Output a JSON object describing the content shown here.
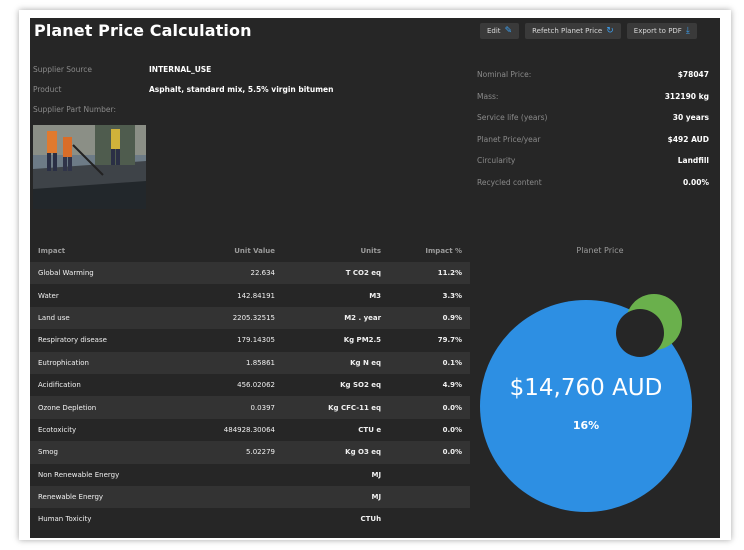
{
  "header": {
    "title": "Planet Price Calculation",
    "edit_label": "Edit",
    "refetch_label": "Refetch Planet Price",
    "export_label": "Export to PDF"
  },
  "info": {
    "supplier_source_label": "Supplier Source",
    "supplier_source_value": "INTERNAL_USE",
    "product_label": "Product",
    "product_value": "Asphalt, standard mix, 5.5% virgin bitumen",
    "part_number_label": "Supplier Part Number:"
  },
  "stats": [
    {
      "label": "Nominal Price:",
      "value": "$78047"
    },
    {
      "label": "Mass:",
      "value": "312190 kg"
    },
    {
      "label": "Service life (years)",
      "value": "30 years"
    },
    {
      "label": "Planet Price/year",
      "value": "$492 AUD"
    },
    {
      "label": "Circularity",
      "value": "Landfill"
    },
    {
      "label": "Recycled content",
      "value": "0.00%"
    }
  ],
  "impact_table": {
    "headers": [
      "Impact",
      "Unit Value",
      "Units",
      "Impact %"
    ],
    "rows": [
      {
        "impact": "Global Warming",
        "value": "22.634",
        "units": "T CO2 eq",
        "pct": "11.2%"
      },
      {
        "impact": "Water",
        "value": "142.84191",
        "units": "M3",
        "pct": "3.3%"
      },
      {
        "impact": "Land use",
        "value": "2205.32515",
        "units": "M2 . year",
        "pct": "0.9%"
      },
      {
        "impact": "Respiratory disease",
        "value": "179.14305",
        "units": "Kg PM2.5",
        "pct": "79.7%"
      },
      {
        "impact": "Eutrophication",
        "value": "1.85861",
        "units": "Kg N eq",
        "pct": "0.1%"
      },
      {
        "impact": "Acidification",
        "value": "456.02062",
        "units": "Kg SO2 eq",
        "pct": "4.9%"
      },
      {
        "impact": "Ozone Depletion",
        "value": "0.0397",
        "units": "Kg CFC-11 eq",
        "pct": "0.0%"
      },
      {
        "impact": "Ecotoxicity",
        "value": "484928.30064",
        "units": "CTU e",
        "pct": "0.0%"
      },
      {
        "impact": "Smog",
        "value": "5.02279",
        "units": "Kg O3 eq",
        "pct": "0.0%"
      },
      {
        "impact": "Non Renewable Energy",
        "value": "",
        "units": "MJ",
        "pct": ""
      },
      {
        "impact": "Renewable Energy",
        "value": "",
        "units": "MJ",
        "pct": ""
      },
      {
        "impact": "Human Toxicity",
        "value": "",
        "units": "CTUh",
        "pct": ""
      }
    ]
  },
  "planet_chart": {
    "title": "Planet Price",
    "value_label": "$14,760 AUD",
    "percent_label": "16%",
    "percent": 16,
    "main_color": "#2d8fe3",
    "accent_color": "#6ab04c"
  }
}
